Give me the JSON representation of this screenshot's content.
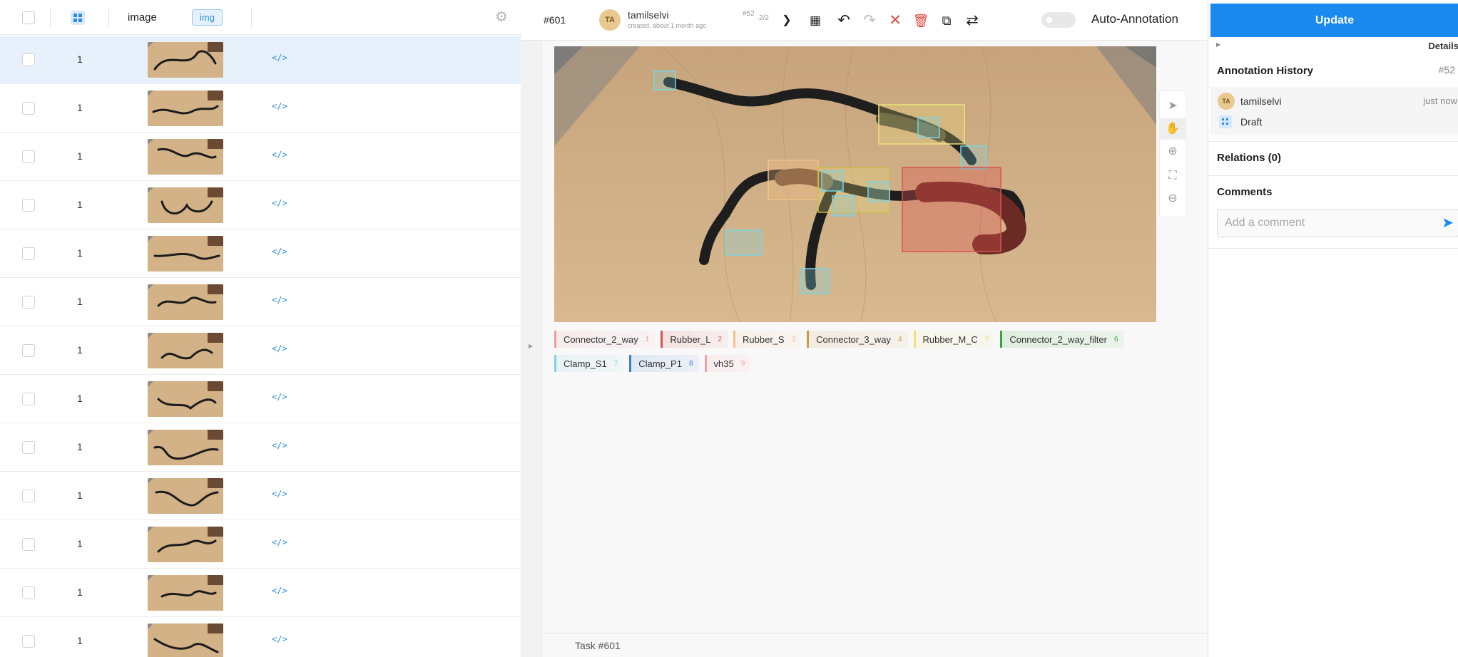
{
  "left": {
    "column_name": "image",
    "column_badge": "img",
    "rows": [
      {
        "num": "1",
        "code": "</>",
        "selected": true
      },
      {
        "num": "1",
        "code": "</>"
      },
      {
        "num": "1",
        "code": "</>"
      },
      {
        "num": "1",
        "code": "</>"
      },
      {
        "num": "1",
        "code": "</>"
      },
      {
        "num": "1",
        "code": "</>"
      },
      {
        "num": "1",
        "code": "</>"
      },
      {
        "num": "1",
        "code": "</>"
      },
      {
        "num": "1",
        "code": "</>"
      },
      {
        "num": "1",
        "code": "</>"
      },
      {
        "num": "1",
        "code": "</>"
      },
      {
        "num": "1",
        "code": "</>"
      },
      {
        "num": "1",
        "code": "</>"
      }
    ]
  },
  "editor": {
    "task_id": "#601",
    "avatar_initials": "TA",
    "user": "tamilselvi",
    "created": "created, about 1 month ago",
    "annotation_id": "#52",
    "pager": "2/2",
    "auto_annotation": "Auto-Annotation",
    "footer": "Task #601",
    "labels": [
      {
        "name": "Connector_2_way",
        "hotkey": "1",
        "color": "#f09a9a"
      },
      {
        "name": "Rubber_L",
        "hotkey": "2",
        "color": "#d9534f"
      },
      {
        "name": "Rubber_S",
        "hotkey": "3",
        "color": "#f5c089"
      },
      {
        "name": "Connector_3_way",
        "hotkey": "4",
        "color": "#c79a45"
      },
      {
        "name": "Rubber_M_C",
        "hotkey": "5",
        "color": "#ece37c"
      },
      {
        "name": "Connector_2_way_filter",
        "hotkey": "6",
        "color": "#3aa63a"
      },
      {
        "name": "Clamp_S1",
        "hotkey": "7",
        "color": "#7fd3de"
      },
      {
        "name": "Clamp_P1",
        "hotkey": "8",
        "color": "#3d7fd6"
      },
      {
        "name": "vh35",
        "hotkey": "9",
        "color": "#f2a3a3"
      }
    ]
  },
  "panel": {
    "update": "Update",
    "details": "Details",
    "history_title": "Annotation History",
    "history_id": "#52",
    "history_avatar": "TA",
    "history_user": "tamilselvi",
    "history_when": "just now",
    "history_status": "Draft",
    "relations": "Relations (0)",
    "comments": "Comments",
    "comment_placeholder": "Add a comment"
  }
}
